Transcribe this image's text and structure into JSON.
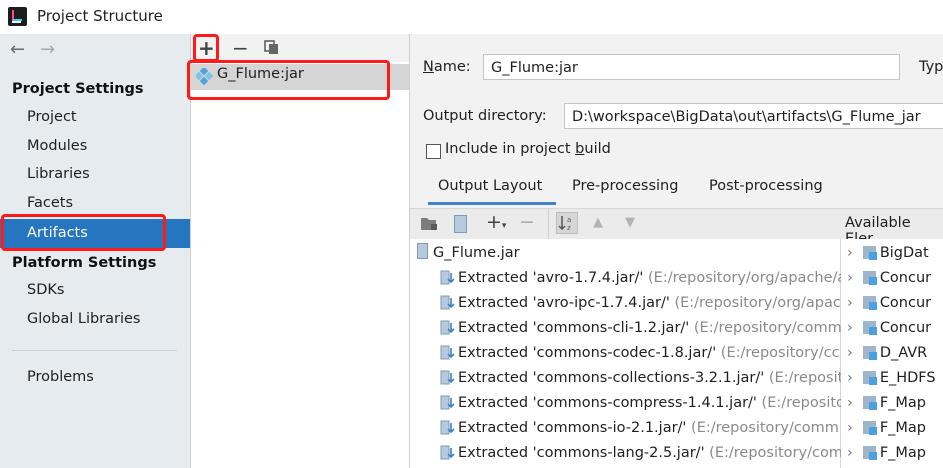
{
  "window": {
    "title": "Project Structure"
  },
  "sidebar": {
    "back_arrow": "←",
    "forward_arrow": "→",
    "project_settings_heading": "Project Settings",
    "project_items": [
      "Project",
      "Modules",
      "Libraries",
      "Facets",
      "Artifacts"
    ],
    "platform_settings_heading": "Platform Settings",
    "platform_items": [
      "SDKs",
      "Global Libraries"
    ],
    "problems": "Problems",
    "selected": "Artifacts"
  },
  "artifacts_list": {
    "toolbar": {
      "add": "+",
      "remove": "−",
      "copy": "copy-icon"
    },
    "items": [
      "G_Flume:jar"
    ]
  },
  "artifact_detail": {
    "name_label": "Name:",
    "name_value": "G_Flume:jar",
    "type_label": "Typ",
    "output_dir_label": "Output directory:",
    "output_dir_value": "D:\\workspace\\BigData\\out\\artifacts\\G_Flume_jar",
    "include_build_label": "Include in project build",
    "include_build_checked": false,
    "tabs": [
      "Output Layout",
      "Pre-processing",
      "Post-processing"
    ],
    "active_tab": "Output Layout",
    "available_elements_label": "Available Eler",
    "root_jar": "G_Flume.jar",
    "extracted": [
      {
        "name": "Extracted 'avro-1.7.4.jar/'",
        "path": "(E:/repository/org/apache/a"
      },
      {
        "name": "Extracted 'avro-ipc-1.7.4.jar/'",
        "path": "(E:/repository/org/apac"
      },
      {
        "name": "Extracted 'commons-cli-1.2.jar/'",
        "path": "(E:/repository/comm"
      },
      {
        "name": "Extracted 'commons-codec-1.8.jar/'",
        "path": "(E:/repository/cc"
      },
      {
        "name": "Extracted 'commons-collections-3.2.1.jar/'",
        "path": "(E:/reposit"
      },
      {
        "name": "Extracted 'commons-compress-1.4.1.jar/'",
        "path": "(E:/reposito"
      },
      {
        "name": "Extracted 'commons-io-2.1.jar/'",
        "path": "(E:/repository/comm"
      },
      {
        "name": "Extracted 'commons-lang-2.5.jar/'",
        "path": "(E:/repository/comm"
      }
    ],
    "available_items": [
      "BigDat",
      "Concur",
      "Concur",
      "Concur",
      "D_AVR",
      "E_HDFS",
      "F_Map",
      "F_Map",
      "F_Map"
    ]
  },
  "colors": {
    "selection": "#2675bf",
    "highlight_box": "#ff1a1a",
    "tab_underline": "#4083c9"
  }
}
